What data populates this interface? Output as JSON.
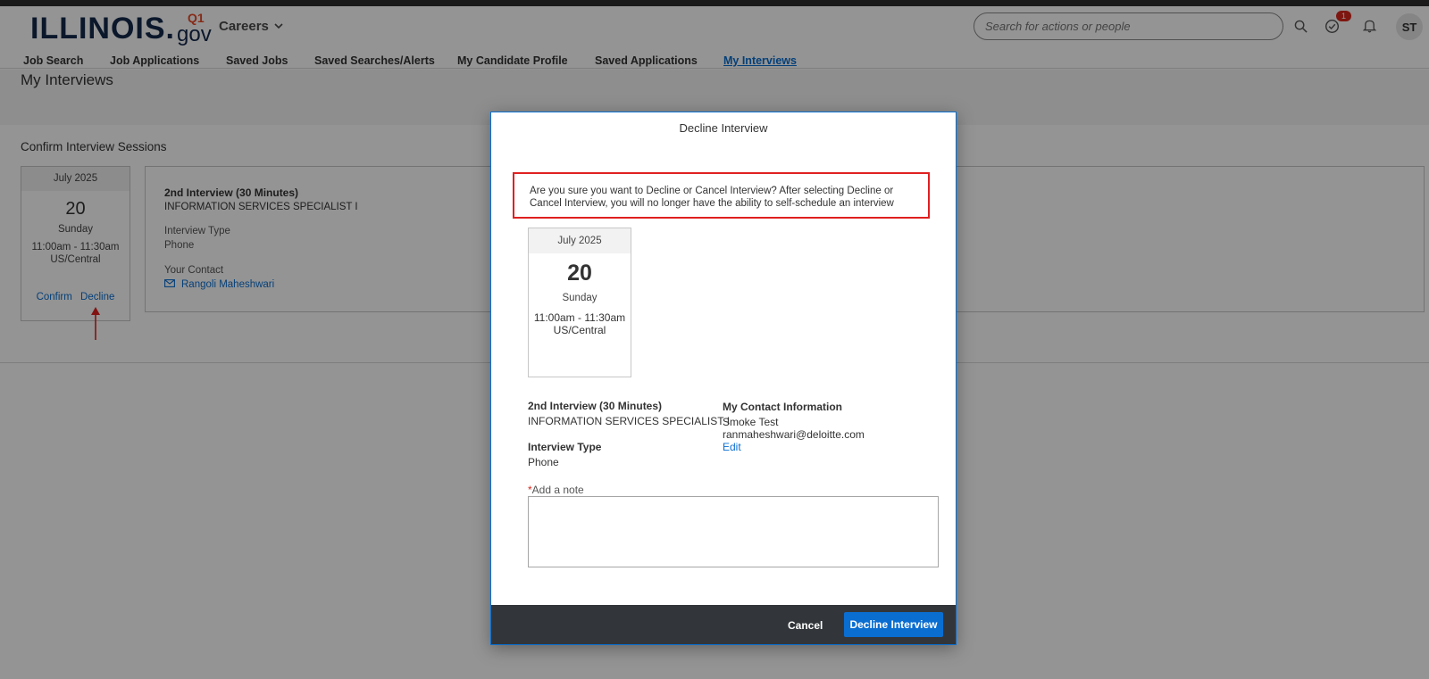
{
  "header": {
    "logo_main": "ILLINOIS.",
    "logo_q1": "Q1",
    "logo_gov": "gov",
    "careers_label": "Careers",
    "search_placeholder": "Search for actions or people",
    "notification_count": "1",
    "avatar_initials": "ST"
  },
  "nav": {
    "items": [
      {
        "label": "Job Search"
      },
      {
        "label": "Job Applications"
      },
      {
        "label": "Saved Jobs"
      },
      {
        "label": "Saved Searches/Alerts"
      },
      {
        "label": "My Candidate Profile"
      },
      {
        "label": "Saved Applications"
      },
      {
        "label": "My Interviews"
      }
    ],
    "active": "My Interviews"
  },
  "page": {
    "title": "My Interviews",
    "section_title": "Confirm Interview Sessions"
  },
  "session_card": {
    "month": "July 2025",
    "day": "20",
    "weekday": "Sunday",
    "time": "11:00am - 11:30am",
    "timezone": "US/Central",
    "confirm_label": "Confirm",
    "decline_label": "Decline"
  },
  "session_details": {
    "title": "2nd Interview (30 Minutes)",
    "position": "INFORMATION SERVICES SPECIALIST I",
    "type_label": "Interview Type",
    "type_value": "Phone",
    "contact_label": "Your Contact",
    "contact_name": "Rangoli Maheshwari"
  },
  "dialog": {
    "title": "Decline Interview",
    "warning": "Are you sure you want to Decline or Cancel Interview? After selecting Decline or Cancel Interview, you will no longer have the ability to self-schedule an interview",
    "card": {
      "month": "July 2025",
      "day": "20",
      "weekday": "Sunday",
      "time": "11:00am - 11:30am",
      "timezone": "US/Central"
    },
    "interview_title": "2nd Interview (30 Minutes)",
    "position": "INFORMATION SERVICES SPECIALIST I",
    "type_label": "Interview Type",
    "type_value": "Phone",
    "contact_heading": "My Contact Information",
    "contact_name": "Smoke Test",
    "contact_email": "ranmaheshwari@deloitte.com",
    "edit_label": "Edit",
    "note_required_mark": "*",
    "note_label": "Add a note",
    "note_value": "",
    "cancel_label": "Cancel",
    "decline_label": "Decline Interview"
  },
  "colors": {
    "brand_navy": "#13294b",
    "brand_orange": "#e84a27",
    "link_blue": "#0a6ed1",
    "warning_red": "#e02020",
    "footer_dark": "#32363a"
  }
}
